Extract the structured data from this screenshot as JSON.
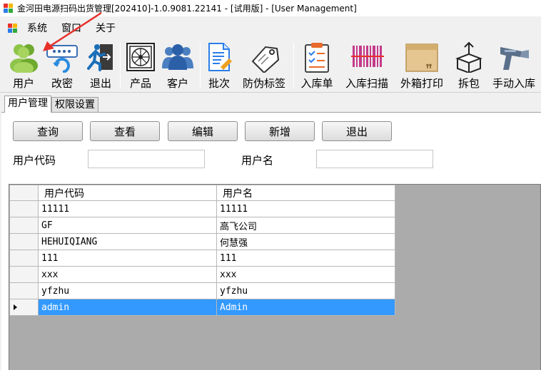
{
  "window": {
    "title": "金河田电源扫码出货管理[202410]-1.0.9081.22141 - [试用版] - [User Management]"
  },
  "menu": {
    "items": [
      {
        "label": "系统"
      },
      {
        "label": "窗口"
      },
      {
        "label": "关于"
      }
    ]
  },
  "toolbar": {
    "items": [
      {
        "label": "用户",
        "icon": "users-icon"
      },
      {
        "label": "改密",
        "icon": "password-change-icon"
      },
      {
        "label": "退出",
        "icon": "exit-icon"
      },
      {
        "label": "产品",
        "icon": "product-icon"
      },
      {
        "label": "客户",
        "icon": "customers-icon"
      },
      {
        "label": "批次",
        "icon": "batch-document-icon"
      },
      {
        "label": "防伪标签",
        "icon": "tag-icon"
      },
      {
        "label": "入库单",
        "icon": "clipboard-icon"
      },
      {
        "label": "入库扫描",
        "icon": "barcode-icon"
      },
      {
        "label": "外箱打印",
        "icon": "box-icon"
      },
      {
        "label": "拆包",
        "icon": "unpack-icon"
      },
      {
        "label": "手动入库",
        "icon": "scanner-icon"
      }
    ]
  },
  "tabs": [
    {
      "label": "用户管理",
      "active": true
    },
    {
      "label": "权限设置",
      "active": false
    }
  ],
  "actions": {
    "query": "查询",
    "view": "查看",
    "edit": "编辑",
    "add": "新增",
    "exit": "退出"
  },
  "filters": {
    "user_code_label": "用户代码",
    "user_code_value": "",
    "user_name_label": "用户名",
    "user_name_value": ""
  },
  "grid": {
    "columns": [
      "用户代码",
      "用户名"
    ],
    "rows": [
      {
        "code": "11111",
        "name": "11111",
        "selected": false
      },
      {
        "code": "GF",
        "name": "高飞公司",
        "selected": false
      },
      {
        "code": "HEHUIQIANG",
        "name": "何慧强",
        "selected": false
      },
      {
        "code": "111",
        "name": "111",
        "selected": false
      },
      {
        "code": "xxx",
        "name": "xxx",
        "selected": false
      },
      {
        "code": "yfzhu",
        "name": "yfzhu",
        "selected": false
      },
      {
        "code": "admin",
        "name": "Admin",
        "selected": true
      }
    ]
  },
  "colors": {
    "selection": "#3399ff",
    "annotation_arrow": "#e8302a"
  }
}
